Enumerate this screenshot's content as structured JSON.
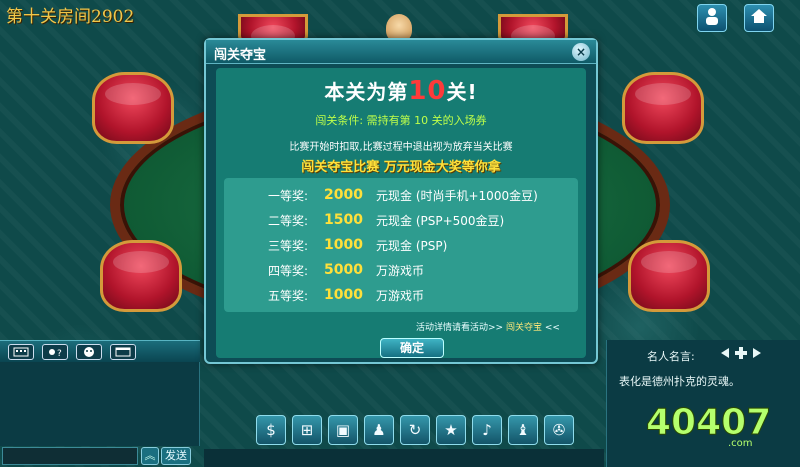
{
  "window": {
    "room_title": "第十关房间2902"
  },
  "top_buttons": [
    {
      "name": "user-icon"
    },
    {
      "name": "home-icon"
    }
  ],
  "modal": {
    "title": "闯关夺宝",
    "close_label": "×",
    "heading_prefix": "本关为第",
    "heading_level": "10",
    "heading_suffix": "关!",
    "condition": "闯关条件: 需持有第 10 关的入场券",
    "notice": "比赛开始时扣取,比赛过程中退出视为放弃当关比赛",
    "slogan": "闯关夺宝比赛 万元现金大奖等你拿",
    "prizes": [
      {
        "rank": "一等奖:",
        "amount": "2000",
        "desc": "元现金 (时尚手机+1000金豆)"
      },
      {
        "rank": "二等奖:",
        "amount": "1500",
        "desc": "元现金 (PSP+500金豆)"
      },
      {
        "rank": "三等奖:",
        "amount": "1000",
        "desc": "元现金 (PSP)"
      },
      {
        "rank": "四等奖:",
        "amount": "5000",
        "desc": "万游戏币"
      },
      {
        "rank": "五等奖:",
        "amount": "1000",
        "desc": "万游戏币"
      }
    ],
    "activity_text": "活动详情请看活动>>",
    "activity_link": "闯关夺宝",
    "activity_suffix": "<<",
    "ok_label": "确定"
  },
  "chat": {
    "send_label": "发送",
    "up_arrow": "︽"
  },
  "right_panel": {
    "quote_header": "名人名言:",
    "quote_text": "表化是德州扑克的灵魂。"
  },
  "watermark": {
    "digits": "40407",
    "domain": ".com"
  },
  "toolbar": {
    "icons": [
      "dollar-icon",
      "cart-icon",
      "card-icon",
      "users-icon",
      "refresh-icon",
      "star-icon",
      "music-icon",
      "people-icon",
      "gear-icon"
    ],
    "glyphs": [
      "$",
      "⊞",
      "▣",
      "♟",
      "↻",
      "★",
      "♪",
      "♝",
      "✇"
    ]
  },
  "colors": {
    "background": "#0f4a4a",
    "accent_gold": "#ffe03a",
    "level_red": "#ff3a3a",
    "condition_green": "#bfff4a"
  }
}
